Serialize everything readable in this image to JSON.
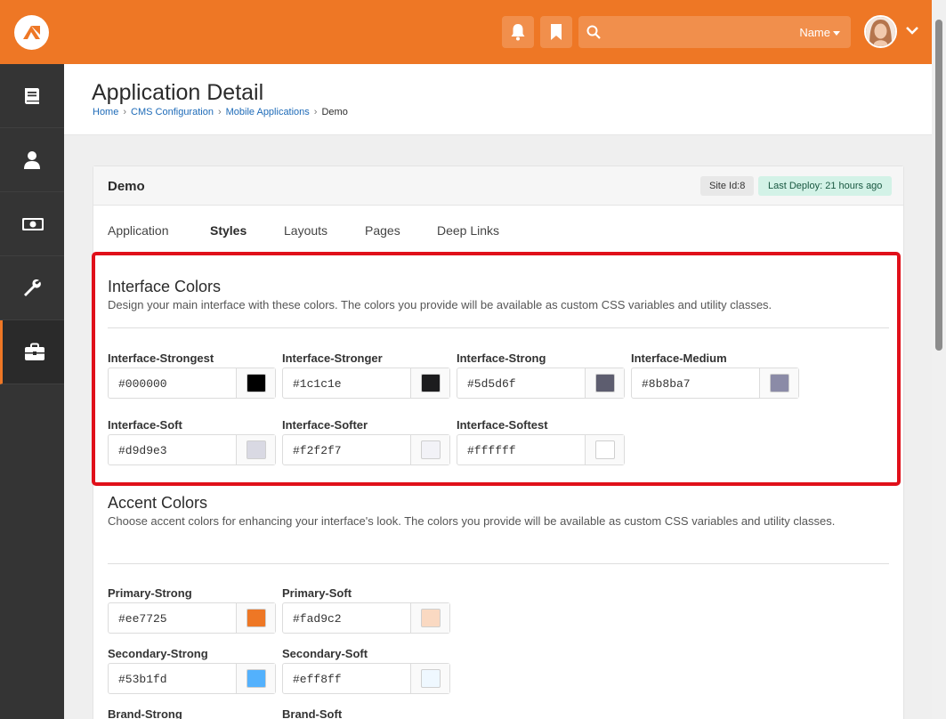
{
  "topbar": {
    "search_filter_label": "Name",
    "brand_color": "#ee7725"
  },
  "sidebar": {
    "items": [
      {
        "icon": "book-icon"
      },
      {
        "icon": "person-icon"
      },
      {
        "icon": "money-icon"
      },
      {
        "icon": "wrench-icon"
      },
      {
        "icon": "briefcase-icon",
        "active": true
      }
    ]
  },
  "page": {
    "title": "Application Detail",
    "breadcrumb": [
      "Home",
      "CMS Configuration",
      "Mobile Applications",
      "Demo"
    ]
  },
  "panel": {
    "title": "Demo",
    "site_id": "Site Id:8",
    "last_deploy": "Last Deploy: 21 hours ago"
  },
  "tabs": [
    "Application",
    "Styles",
    "Layouts",
    "Pages",
    "Deep Links"
  ],
  "interface_colors": {
    "title": "Interface Colors",
    "description": "Design your main interface with these colors. The colors you provide will be available as custom CSS variables and utility classes.",
    "fields": [
      {
        "label": "Interface-Strongest",
        "value": "#000000"
      },
      {
        "label": "Interface-Stronger",
        "value": "#1c1c1e"
      },
      {
        "label": "Interface-Strong",
        "value": "#5d5d6f"
      },
      {
        "label": "Interface-Medium",
        "value": "#8b8ba7"
      },
      {
        "label": "Interface-Soft",
        "value": "#d9d9e3"
      },
      {
        "label": "Interface-Softer",
        "value": "#f2f2f7"
      },
      {
        "label": "Interface-Softest",
        "value": "#ffffff"
      }
    ]
  },
  "accent_colors": {
    "title": "Accent Colors",
    "description": "Choose accent colors for enhancing your interface's look. The colors you provide will be available as custom CSS variables and utility classes.",
    "fields": [
      {
        "label": "Primary-Strong",
        "value": "#ee7725"
      },
      {
        "label": "Primary-Soft",
        "value": "#fad9c2"
      },
      {
        "label": "Secondary-Strong",
        "value": "#53b1fd"
      },
      {
        "label": "Secondary-Soft",
        "value": "#eff8ff"
      },
      {
        "label": "Brand-Strong",
        "value": ""
      },
      {
        "label": "Brand-Soft",
        "value": ""
      }
    ]
  },
  "highlight_color": "#e0101a"
}
